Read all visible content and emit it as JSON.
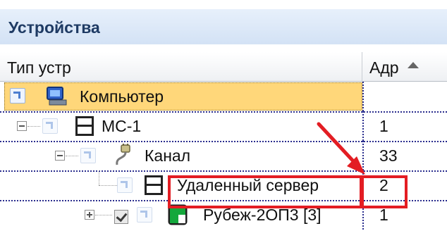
{
  "panel": {
    "title": "Устройства"
  },
  "columns": {
    "type": "Тип устр",
    "address": "Адр"
  },
  "rows": [
    {
      "label": "Компьютер",
      "address": "",
      "icon": "computer-icon",
      "selected": true
    },
    {
      "label": "МС-1",
      "address": "1",
      "icon": "module-icon",
      "expanded": true
    },
    {
      "label": "Канал",
      "address": "33",
      "icon": "channel-plug-icon",
      "expanded": true
    },
    {
      "label": "Удаленный сервер",
      "address": "2",
      "icon": "module-icon",
      "highlighted": true
    },
    {
      "label": "Рубеж-2ОП3 [3]",
      "address": "1",
      "icon": "panel-device-icon",
      "expanded": false,
      "checked": true
    }
  ],
  "colors": {
    "selection": "#ffd77a",
    "highlight": "#e31d23",
    "grid_dots": "#2b2e8e",
    "header_text": "#1f3b64"
  }
}
